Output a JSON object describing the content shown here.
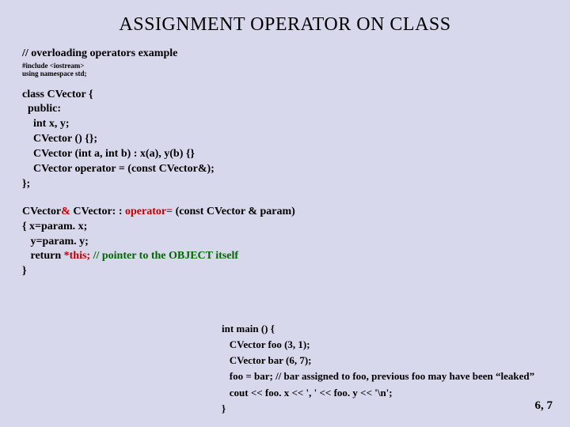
{
  "title": "ASSIGNMENT OPERATOR ON CLASS",
  "c1": "// overloading operators example",
  "c2": "#include <iostream>",
  "c3": "using namespace std;",
  "d1": "class  CVector {",
  "d2": "  public:",
  "d3": "    int  x, y;",
  "d4": "    CVector () {};",
  "d5": "    CVector (int a, int b) :  x(a), y(b) {}",
  "d6": "    CVector  operator = (const   CVector&);",
  "d7": "};",
  "e1a": "CVector",
  "e1amp": "&",
  "e1b": "   CVector: : ",
  "e1op": "operator=",
  "e1c": "   (const  CVector & param)",
  "e2": "{ x=param. x;",
  "e3": "   y=param. y;",
  "e4a": "   return  ",
  "e4this": "*this;",
  "e4b": "   // pointer to the OBJECT itself",
  "e5": "}",
  "m1": "int main () {",
  "m2": "   CVector  foo (3, 1);",
  "m3": "   CVector  bar (6, 7);",
  "m4": "   foo =   bar;   // bar assigned to foo, previous foo may have been “leaked”",
  "m5": "   cout << foo. x << ', ' << foo. y << '\\n';",
  "m6": "}",
  "out": "6, 7"
}
